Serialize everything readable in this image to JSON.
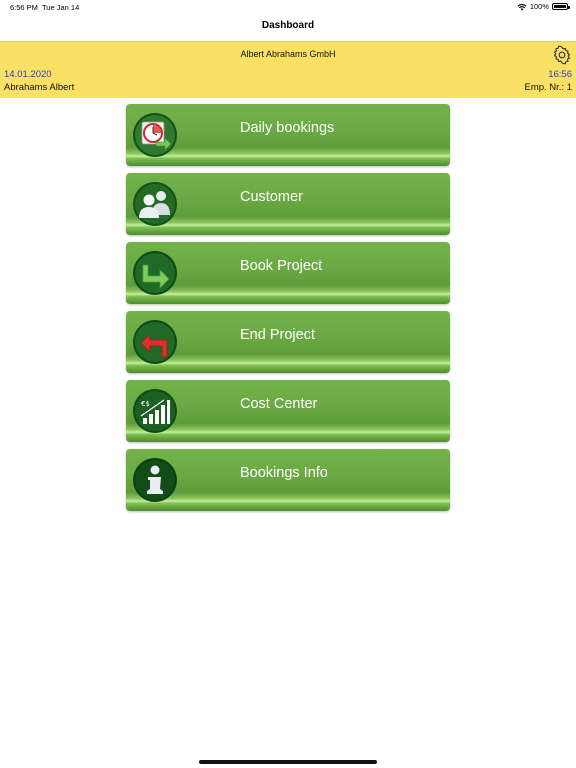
{
  "status_bar": {
    "time": "6:56 PM",
    "date": "Tue Jan 14",
    "battery": "100%"
  },
  "nav": {
    "title": "Dashboard"
  },
  "header": {
    "company": "Albert Abrahams GmbH",
    "date": "14.01.2020",
    "time": "16:56",
    "employee_name": "Abrahams Albert",
    "employee_number": "Emp. Nr.:  1",
    "background_color": "#fbe066",
    "accent_text_color": "#2a3bd0"
  },
  "menu": {
    "items": [
      {
        "label": "Daily bookings",
        "icon": "clock-calendar-icon"
      },
      {
        "label": "Customer",
        "icon": "users-icon"
      },
      {
        "label": "Book Project",
        "icon": "arrow-right-icon"
      },
      {
        "label": "End Project",
        "icon": "arrow-left-icon"
      },
      {
        "label": "Cost Center",
        "icon": "bar-chart-euro-icon"
      },
      {
        "label": "Bookings Info",
        "icon": "info-icon"
      }
    ],
    "button_color": "#6aa843"
  }
}
